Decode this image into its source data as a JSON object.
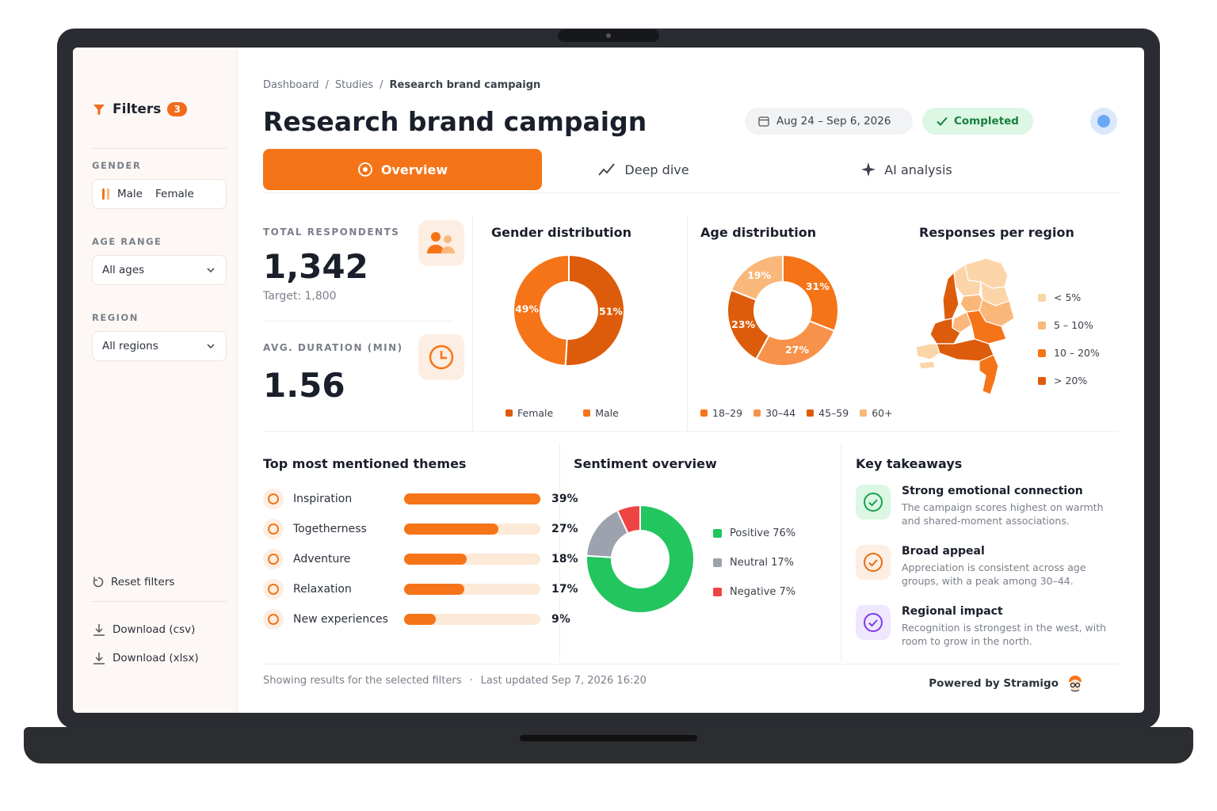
{
  "sidebar": {
    "filters_title": "Filters",
    "filters_count": "3",
    "gender_label": "GENDER",
    "gender_male": "Male",
    "gender_female": "Female",
    "age_label": "AGE RANGE",
    "age_value": "All ages",
    "region_label": "REGION",
    "region_value": "All regions",
    "reset": "Reset filters",
    "download_csv": "Download (csv)",
    "download_xlsx": "Download (xlsx)"
  },
  "breadcrumb": {
    "home": "Dashboard",
    "studies": "Studies",
    "current": "Research brand campaign",
    "sep": "/"
  },
  "header": {
    "title": "Research brand campaign",
    "date_range": "Aug 24 – Sep 6, 2026",
    "status": "Completed"
  },
  "tabs": [
    {
      "label": "Overview",
      "active": true
    },
    {
      "label": "Deep dive",
      "active": false
    },
    {
      "label": "AI analysis",
      "active": false
    }
  ],
  "kpis": {
    "respondents_label": "TOTAL RESPONDENTS",
    "respondents_value": "1,342",
    "respondents_target": "Target: 1,800",
    "duration_label": "AVG. DURATION (MIN)",
    "duration_value": "1.56"
  },
  "gender_chart": {
    "title": "Gender distribution",
    "slices": [
      {
        "name": "Female",
        "value": 51,
        "label": "51%",
        "color": "#dd5c0b"
      },
      {
        "name": "Male",
        "value": 49,
        "label": "49%",
        "color": "#f57418"
      }
    ]
  },
  "age_chart": {
    "title": "Age distribution",
    "slices": [
      {
        "name": "18–29",
        "value": 31,
        "label": "31%",
        "color": "#f57418"
      },
      {
        "name": "30–44",
        "value": 27,
        "label": "27%",
        "color": "#f8924a"
      },
      {
        "name": "45–59",
        "value": 23,
        "label": "23%",
        "color": "#dd5c0b"
      },
      {
        "name": "60+",
        "value": 19,
        "label": "19%",
        "color": "#f9b87a"
      }
    ],
    "legend": [
      {
        "name": "18–29",
        "color": "#f57418"
      },
      {
        "name": "30–44",
        "color": "#f8924a"
      },
      {
        "name": "45–59",
        "color": "#dd5c0b"
      },
      {
        "name": "60+",
        "color": "#f9b87a"
      }
    ]
  },
  "region_map": {
    "title": "Responses per region",
    "legend": [
      {
        "label": "< 5%",
        "color": "#fbd5a8"
      },
      {
        "label": "5 – 10%",
        "color": "#f9b87a"
      },
      {
        "label": "10 – 20%",
        "color": "#f57418"
      },
      {
        "label": "> 20%",
        "color": "#dd5c0b"
      }
    ]
  },
  "themes": {
    "title": "Top most mentioned themes",
    "items": [
      {
        "label": "Inspiration",
        "pct": "39%",
        "fill": 1.0
      },
      {
        "label": "Togetherness",
        "pct": "27%",
        "fill": 0.69
      },
      {
        "label": "Adventure",
        "pct": "18%",
        "fill": 0.46
      },
      {
        "label": "Relaxation",
        "pct": "17%",
        "fill": 0.44
      },
      {
        "label": "New experiences",
        "pct": "9%",
        "fill": 0.23
      }
    ]
  },
  "sentiment": {
    "title": "Sentiment overview",
    "slices": [
      {
        "name": "Positive",
        "value": 76,
        "label": "Positive 76%",
        "color": "#22c55e"
      },
      {
        "name": "Neutral",
        "value": 17,
        "label": "Neutral 17%",
        "color": "#9ca3af"
      },
      {
        "name": "Negative",
        "value": 7,
        "label": "Negative 7%",
        "color": "#ef4444"
      }
    ]
  },
  "takeaways": {
    "title": "Key takeaways",
    "items": [
      {
        "title": "Strong emotional connection",
        "body": "The campaign scores highest on warmth and shared-moment associations.",
        "color": "#16a34a",
        "bg": "#dcf7e4"
      },
      {
        "title": "Broad appeal",
        "body": "Appreciation is consistent across age groups, with a peak among 30–44.",
        "color": "#ea6a10",
        "bg": "#fdeee3"
      },
      {
        "title": "Regional impact",
        "body": "Recognition is strongest in the west, with room to grow in the north.",
        "color": "#7c3aed",
        "bg": "#efe7fd"
      }
    ]
  },
  "footer": {
    "filters_note": "Showing results for the selected filters",
    "dot": "·",
    "updated": "Last updated Sep 7, 2026 16:20",
    "powered": "Powered by Stramigo"
  }
}
